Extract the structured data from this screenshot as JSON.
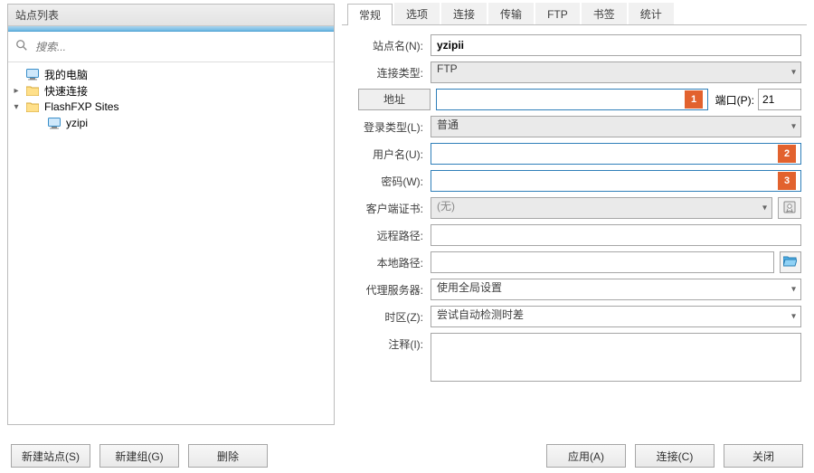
{
  "left": {
    "title": "站点列表",
    "search_placeholder": "搜索...",
    "tree": [
      {
        "label": "我的电脑",
        "icon": "monitor"
      },
      {
        "label": "快速连接",
        "icon": "folder"
      },
      {
        "label": "FlashFXP Sites",
        "icon": "folder",
        "expanded": true,
        "children": [
          {
            "label": "yzipi",
            "icon": "monitor"
          }
        ]
      }
    ]
  },
  "tabs": [
    "常规",
    "选项",
    "连接",
    "传输",
    "FTP",
    "书签",
    "统计"
  ],
  "form": {
    "site_name_label": "站点名(N):",
    "site_name_value": "yzipii",
    "conn_type_label": "连接类型:",
    "conn_type_value": "FTP",
    "addr_button": "地址",
    "marker1": "1",
    "port_label": "端口(P):",
    "port_value": "21",
    "login_type_label": "登录类型(L):",
    "login_type_value": "普通",
    "user_label": "用户名(U):",
    "marker2": "2",
    "pass_label": "密码(W):",
    "marker3": "3",
    "cert_label": "客户端证书:",
    "cert_value": "(无)",
    "remote_path_label": "远程路径:",
    "local_path_label": "本地路径:",
    "proxy_label": "代理服务器:",
    "proxy_value": "使用全局设置",
    "tz_label": "时区(Z):",
    "tz_value": "尝试自动检测时差",
    "notes_label": "注释(I):"
  },
  "buttons": {
    "new_site": "新建站点(S)",
    "new_group": "新建组(G)",
    "delete": "删除",
    "apply": "应用(A)",
    "connect": "连接(C)",
    "close": "关闭"
  }
}
